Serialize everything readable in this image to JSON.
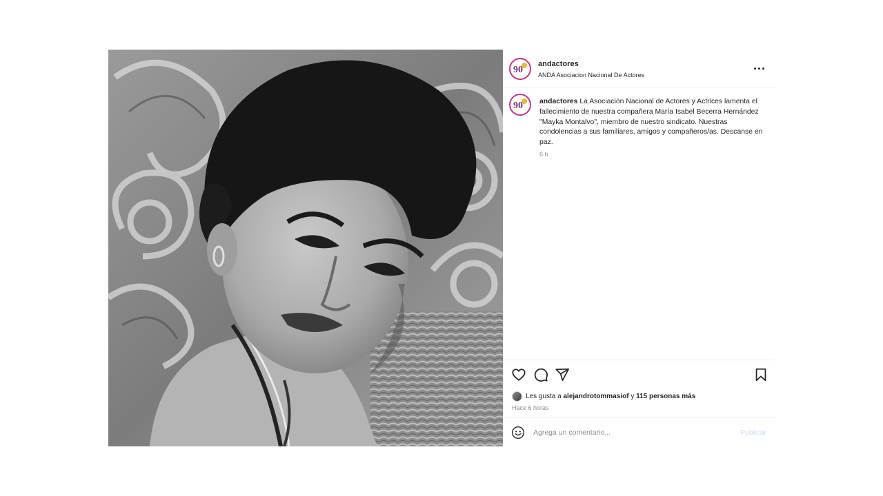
{
  "post": {
    "username": "andactores",
    "profile_subtitle": "ANDA Asociacion Nacional De Actores",
    "avatar_logo_text": "90",
    "caption_text": "La Asociación Nacional de Actores y Actrices lamenta el fallecimiento de nuestra compañera María Isabel Becerra Hernández \"Mayka Montalvo\", miembro de nuestro sindicato. Nuestras condolencias a sus familiares, amigos y compañeros/as. Descanse en paz.",
    "caption_time": "6 h",
    "photo_icon": "black-and-white-portrait-photo"
  },
  "actions": {
    "icons": [
      "heart-icon",
      "comment-icon",
      "share-icon",
      "bookmark-icon"
    ]
  },
  "likes": {
    "prefix": "Les gusta a",
    "user": "alejandrotommasiof",
    "connector": "y",
    "others": "115 personas más"
  },
  "timestamp": "Hace 6 horas",
  "comment": {
    "placeholder": "Agrega un comentario...",
    "publish_label": "Publicar",
    "emoji_icon": "emoji-icon"
  },
  "colors": {
    "text": "#262626",
    "muted": "#8e8e8e",
    "publish_disabled": "#c7def7",
    "avatar_ring": "#c1358c",
    "divider": "#efefef"
  }
}
